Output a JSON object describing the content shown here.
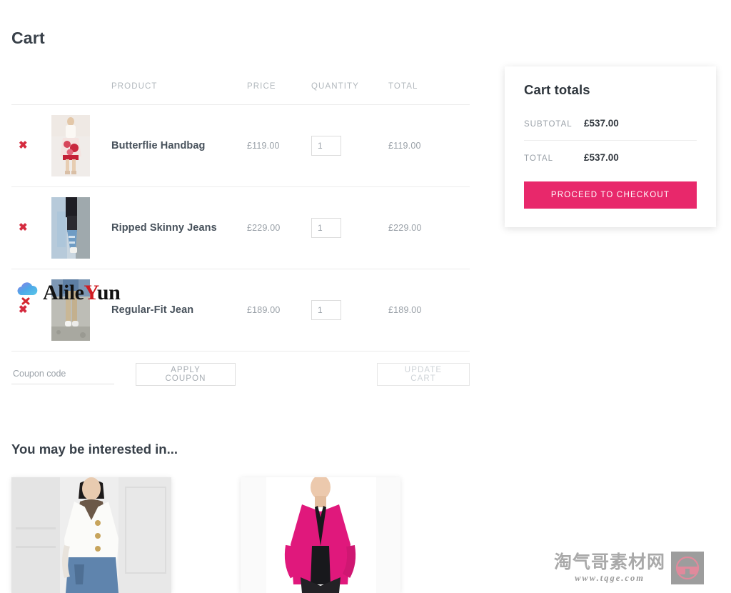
{
  "page": {
    "title": "Cart"
  },
  "cart_table": {
    "columns": {
      "remove": "",
      "thumbnail": "",
      "product": "PRODUCT",
      "price": "PRICE",
      "quantity": "QUANTITY",
      "total": "TOTAL"
    },
    "remove_glyph": "✖",
    "rows": [
      {
        "name": "Butterflie Handbag",
        "price": "£119.00",
        "quantity": "1",
        "total": "£119.00",
        "thumb_name": "product-thumbnail-butterflie-handbag"
      },
      {
        "name": "Ripped Skinny Jeans",
        "price": "£229.00",
        "quantity": "1",
        "total": "£229.00",
        "thumb_name": "product-thumbnail-ripped-skinny-jeans"
      },
      {
        "name": "Regular-Fit Jean",
        "price": "£189.00",
        "quantity": "1",
        "total": "£189.00",
        "thumb_name": "product-thumbnail-regular-fit-jean"
      }
    ]
  },
  "coupon": {
    "placeholder": "Coupon code",
    "value": "",
    "apply_label": "APPLY COUPON",
    "update_label": "UPDATE CART"
  },
  "cart_totals": {
    "title": "Cart totals",
    "subtotal_label": "SUBTOTAL",
    "subtotal_value": "£537.00",
    "total_label": "TOTAL",
    "total_value": "£537.00",
    "checkout_label": "PROCEED TO CHECKOUT"
  },
  "related": {
    "title": "You may be interested in...",
    "items": [
      {
        "image_name": "related-product-image-white-blazer"
      },
      {
        "image_name": "related-product-image-pink-blazer"
      }
    ]
  },
  "watermarks": {
    "alileyun": {
      "text_before": "Alile",
      "text_highlight": "Y",
      "text_after": "un"
    },
    "tqge": {
      "cn": "淘气哥素材网",
      "url": "www.tqge.com"
    }
  },
  "colors": {
    "accent_pink": "#e8286b",
    "remove_red": "#d52b3f",
    "muted_text": "#9aa1a8",
    "heading_text": "#384049"
  }
}
